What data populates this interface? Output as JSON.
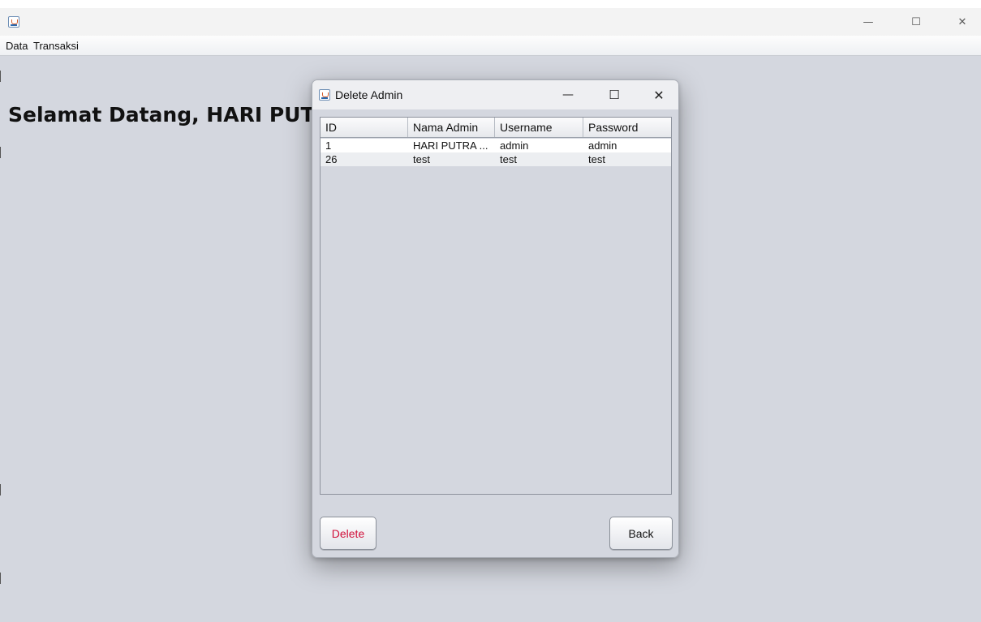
{
  "menubar": {
    "items": [
      "Data",
      "Transaksi"
    ]
  },
  "main": {
    "welcome_text": "Selamat Datang, HARI PUTRA"
  },
  "dialog": {
    "title": "Delete Admin",
    "table": {
      "columns": [
        "ID",
        "Nama Admin",
        "Username",
        "Password"
      ],
      "rows": [
        [
          "1",
          "HARI PUTRA ...",
          "admin",
          "admin"
        ],
        [
          "26",
          "test",
          "test",
          "test"
        ]
      ]
    },
    "delete_label": "Delete",
    "back_label": "Back"
  },
  "colors": {
    "delete_text": "#d0103a",
    "content_bg": "#d4d7df"
  },
  "icons": {
    "window_icon": "java-coffee-cup-icon"
  }
}
